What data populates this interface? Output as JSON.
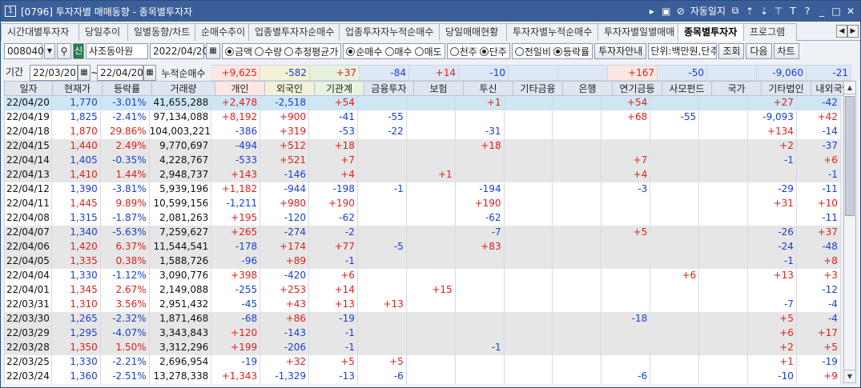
{
  "window": {
    "num": "1",
    "title": "[0796] 투자자별 매매동향 - 종목별투자자",
    "auto_journal": "자동일지",
    "right_icons": [
      "⊘",
      "T",
      "?",
      "_",
      "□",
      "✕"
    ]
  },
  "tabs": [
    "시간대별투자자",
    "당일추이",
    "일별동향/차트",
    "순매수추이",
    "업종별투자자순매수",
    "업종투자자누적순매수",
    "당일매매현황",
    "투자자별누적순매수",
    "투자자별일별매매",
    "종목별투자자",
    "프로그램"
  ],
  "active_tab": 9,
  "controls": {
    "code": "008040",
    "name": "사조동아원",
    "date": "2022/04/20",
    "r_amount": "금액",
    "r_qty": "수량",
    "r_avg": "추정평균가",
    "r_net": "순매수",
    "r_buy": "매수",
    "r_sell": "매도",
    "r_thou": "천주",
    "r_unit": "단주",
    "r_prev": "전일비",
    "r_rate": "등락률",
    "guide_btn": "투자자안내",
    "unit_text": "단위:백만원,단주",
    "query_btn": "조회",
    "next_btn": "다음",
    "chart_btn": "차트",
    "sin": "신"
  },
  "period": {
    "label": "기간",
    "from": "22/03/20",
    "tilde": "~",
    "to": "22/04/20",
    "cum_label": "누적순매수"
  },
  "summary": [
    "+9,625",
    "-582",
    "+37",
    "-84",
    "+14",
    "-10",
    "",
    "",
    "+167",
    "-50",
    "",
    "-9,060",
    "-21"
  ],
  "headers": [
    "일자",
    "현재가",
    "등락률",
    "거래량",
    "개인",
    "외국인",
    "기관계",
    "금융투자",
    "보험",
    "투신",
    "기타금융",
    "은행",
    "연기금등",
    "사모펀드",
    "국가",
    "기타법인",
    "내외국인"
  ],
  "rows": [
    {
      "d": "22/04/20",
      "p": "1,770",
      "r": "-3.01%",
      "v": "41,655,288",
      "cols": [
        "+2,478",
        "-2,518",
        "+54",
        "",
        "",
        "+1",
        "",
        "",
        "+54",
        "",
        "",
        "+27",
        "-42"
      ]
    },
    {
      "d": "22/04/19",
      "p": "1,825",
      "r": "-2.41%",
      "v": "97,134,088",
      "cols": [
        "+8,192",
        "+900",
        "-41",
        "-55",
        "",
        "",
        "",
        "",
        "+68",
        "-55",
        "",
        "-9,093",
        "+42"
      ]
    },
    {
      "d": "22/04/18",
      "p": "1,870",
      "r": "29.86%",
      "v": "104,003,221",
      "cols": [
        "-386",
        "+319",
        "-53",
        "-22",
        "",
        "-31",
        "",
        "",
        "",
        "",
        "",
        "+134",
        "-14"
      ]
    },
    {
      "d": "22/04/15",
      "p": "1,440",
      "r": "2.49%",
      "v": "9,770,697",
      "cols": [
        "-494",
        "+512",
        "+18",
        "",
        "",
        "+18",
        "",
        "",
        "",
        "",
        "",
        "+2",
        "-37"
      ]
    },
    {
      "d": "22/04/14",
      "p": "1,405",
      "r": "-0.35%",
      "v": "4,228,767",
      "cols": [
        "-533",
        "+521",
        "+7",
        "",
        "",
        "",
        "",
        "",
        "+7",
        "",
        "",
        "-1",
        "+6"
      ]
    },
    {
      "d": "22/04/13",
      "p": "1,410",
      "r": "1.44%",
      "v": "2,948,737",
      "cols": [
        "+143",
        "-146",
        "+4",
        "",
        "+1",
        "",
        "",
        "",
        "+4",
        "",
        "",
        "",
        "-1"
      ]
    },
    {
      "d": "22/04/12",
      "p": "1,390",
      "r": "-3.81%",
      "v": "5,939,196",
      "cols": [
        "+1,182",
        "-944",
        "-198",
        "-1",
        "",
        "-194",
        "",
        "",
        "-3",
        "",
        "",
        "-29",
        "-11"
      ]
    },
    {
      "d": "22/04/11",
      "p": "1,445",
      "r": "9.89%",
      "v": "10,599,156",
      "cols": [
        "-1,211",
        "+980",
        "+190",
        "",
        "",
        "+190",
        "",
        "",
        "",
        "",
        "",
        "+31",
        "+10"
      ]
    },
    {
      "d": "22/04/08",
      "p": "1,315",
      "r": "-1.87%",
      "v": "2,081,263",
      "cols": [
        "+195",
        "-120",
        "-62",
        "",
        "",
        "-62",
        "",
        "",
        "",
        "",
        "",
        "",
        "-11"
      ]
    },
    {
      "d": "22/04/07",
      "p": "1,340",
      "r": "-5.63%",
      "v": "7,259,627",
      "cols": [
        "+265",
        "-274",
        "-2",
        "",
        "",
        "-7",
        "",
        "",
        "+5",
        "",
        "",
        "-26",
        "+37"
      ]
    },
    {
      "d": "22/04/06",
      "p": "1,420",
      "r": "6.37%",
      "v": "11,544,541",
      "cols": [
        "-178",
        "+174",
        "+77",
        "-5",
        "",
        "+83",
        "",
        "",
        "",
        "",
        "",
        "-24",
        "-48"
      ]
    },
    {
      "d": "22/04/05",
      "p": "1,335",
      "r": "0.38%",
      "v": "1,588,726",
      "cols": [
        "-96",
        "+89",
        "-1",
        "",
        "",
        "",
        "",
        "",
        "",
        "",
        "",
        "-1",
        "+8"
      ]
    },
    {
      "d": "22/04/04",
      "p": "1,330",
      "r": "-1.12%",
      "v": "3,090,776",
      "cols": [
        "+398",
        "-420",
        "+6",
        "",
        "",
        "",
        "",
        "",
        "",
        "+6",
        "",
        "+13",
        "+3"
      ]
    },
    {
      "d": "22/04/01",
      "p": "1,345",
      "r": "2.67%",
      "v": "2,149,088",
      "cols": [
        "-255",
        "+253",
        "+14",
        "",
        "+15",
        "",
        "",
        "",
        "",
        "",
        "",
        "",
        "-12"
      ]
    },
    {
      "d": "22/03/31",
      "p": "1,310",
      "r": "3.56%",
      "v": "2,951,432",
      "cols": [
        "-45",
        "+43",
        "+13",
        "+13",
        "",
        "",
        "",
        "",
        "",
        "",
        "",
        "-7",
        "-4"
      ]
    },
    {
      "d": "22/03/30",
      "p": "1,265",
      "r": "-2.32%",
      "v": "1,871,468",
      "cols": [
        "-68",
        "+86",
        "-19",
        "",
        "",
        "",
        "",
        "",
        "-18",
        "",
        "",
        "+5",
        "-4"
      ]
    },
    {
      "d": "22/03/29",
      "p": "1,295",
      "r": "-4.07%",
      "v": "3,343,843",
      "cols": [
        "+120",
        "-143",
        "-1",
        "",
        "",
        "",
        "",
        "",
        "",
        "",
        "",
        "+6",
        "+17"
      ]
    },
    {
      "d": "22/03/28",
      "p": "1,350",
      "r": "1.50%",
      "v": "3,312,296",
      "cols": [
        "+199",
        "-206",
        "-1",
        "",
        "",
        "-1",
        "",
        "",
        "",
        "",
        "",
        "+2",
        "+5"
      ]
    },
    {
      "d": "22/03/25",
      "p": "1,330",
      "r": "-2.21%",
      "v": "2,696,954",
      "cols": [
        "-19",
        "+32",
        "+5",
        "+5",
        "",
        "",
        "",
        "",
        "",
        "",
        "",
        "+1",
        "-19"
      ]
    },
    {
      "d": "22/03/24",
      "p": "1,360",
      "r": "-2.51%",
      "v": "13,278,338",
      "cols": [
        "+1,343",
        "-1,329",
        "-13",
        "-6",
        "",
        "",
        "",
        "",
        "-6",
        "",
        "",
        "-10",
        "+9"
      ]
    }
  ],
  "colors": {
    "title_bg": "#3a5f98",
    "selected_row": "#cfe6f4",
    "positive": "#e0201a",
    "negative": "#1a3fd0"
  }
}
